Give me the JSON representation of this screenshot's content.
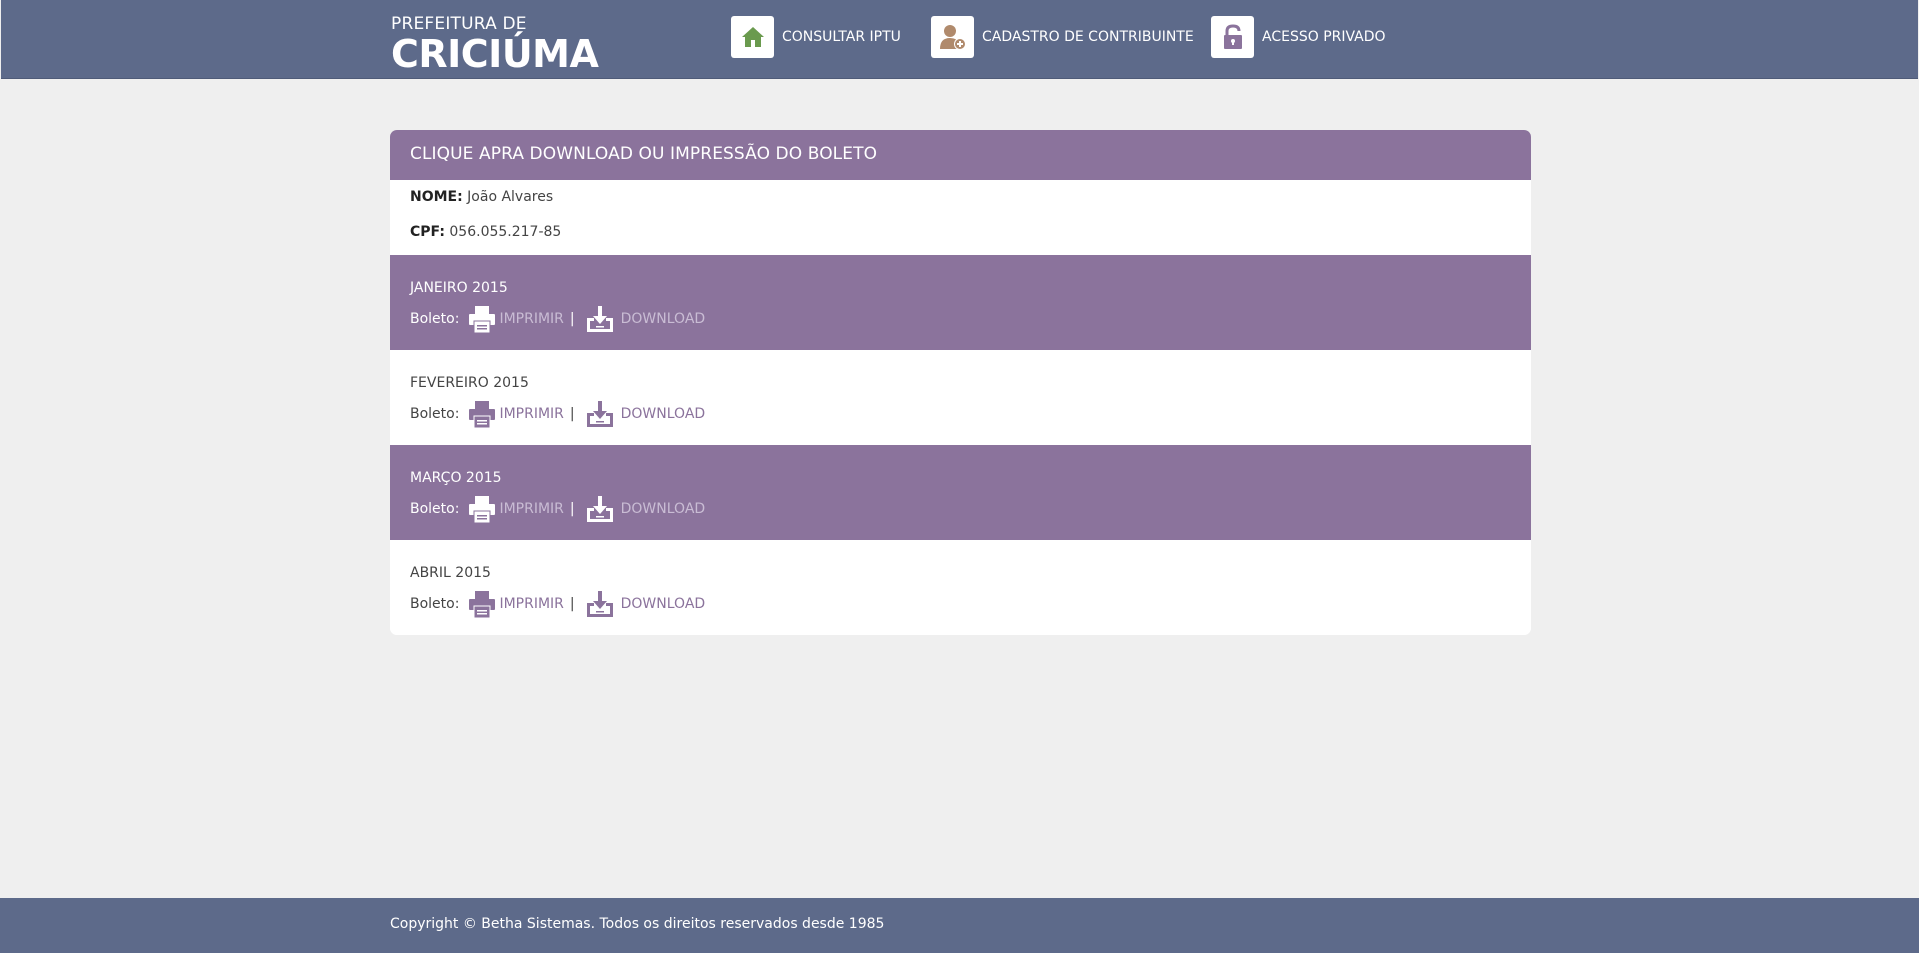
{
  "header": {
    "brand_small": "PREFEITURA DE",
    "brand_big": "CRICIÚMA",
    "nav": [
      {
        "label": "CONSULTAR IPTU",
        "icon": "house-icon",
        "color": "#6a9a4e"
      },
      {
        "label": "CADASTRO DE CONTRIBUINTE",
        "icon": "add-user-icon",
        "color": "#b08a6c"
      },
      {
        "label": "ACESSO PRIVADO",
        "icon": "lock-icon",
        "color": "#8b739c"
      }
    ]
  },
  "card": {
    "title": "CLIQUE APRA DOWNLOAD OU IMPRESSÃO DO BOLETO",
    "nome_label": "NOME:",
    "nome_value": "João Alvares",
    "cpf_label": "CPF:",
    "cpf_value": "056.055.217-85",
    "boleto_label": "Boleto:",
    "print_label": "IMPRIMIR",
    "separator": "|",
    "download_label": "DOWNLOAD",
    "months": [
      {
        "title": "JANEIRO 2015"
      },
      {
        "title": "FEVEREIRO 2015"
      },
      {
        "title": "MARÇO 2015"
      },
      {
        "title": "ABRIL 2015"
      }
    ]
  },
  "colors": {
    "header_bg": "#5d6a8a",
    "accent_purple": "#8b739c",
    "page_bg": "#efefef"
  },
  "footer": {
    "text": "Copyright © Betha Sistemas. Todos os direitos reservados desde 1985"
  }
}
